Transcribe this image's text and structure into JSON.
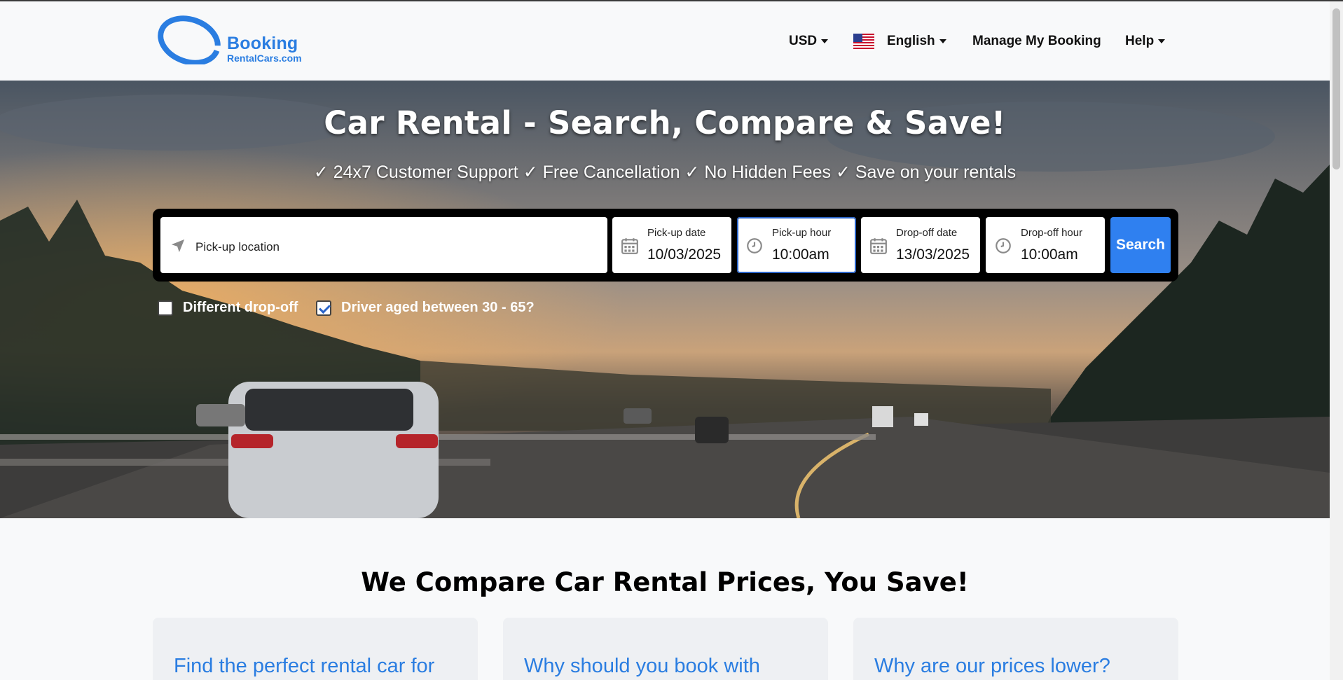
{
  "header": {
    "brand_line1": "Booking",
    "brand_line2": "RentalCars.com",
    "currency": "USD",
    "language": "English",
    "manage_booking": "Manage My Booking",
    "help": "Help"
  },
  "hero": {
    "title": "Car Rental - Search, Compare & Save!",
    "subtitle": "✓ 24x7 Customer Support ✓ Free Cancellation ✓ No Hidden Fees ✓ Save on your rentals"
  },
  "search": {
    "pickup_location_placeholder": "Pick-up location",
    "pickup_date_label": "Pick-up date",
    "pickup_date_value": "10/03/2025",
    "pickup_hour_label": "Pick-up hour",
    "pickup_hour_value": "10:00am",
    "dropoff_date_label": "Drop-off date",
    "dropoff_date_value": "13/03/2025",
    "dropoff_hour_label": "Drop-off hour",
    "dropoff_hour_value": "10:00am",
    "search_button": "Search"
  },
  "options": {
    "different_dropoff": "Different drop-off",
    "different_dropoff_checked": false,
    "driver_age": "Driver aged between 30 - 65?",
    "driver_age_checked": true
  },
  "section": {
    "title": "We Compare Car Rental Prices, You Save!",
    "cards": [
      "Find the perfect rental car for",
      "Why should you book with",
      "Why are our prices lower?"
    ]
  },
  "colors": {
    "accent": "#2f80f0",
    "brand": "#2a7de1"
  }
}
